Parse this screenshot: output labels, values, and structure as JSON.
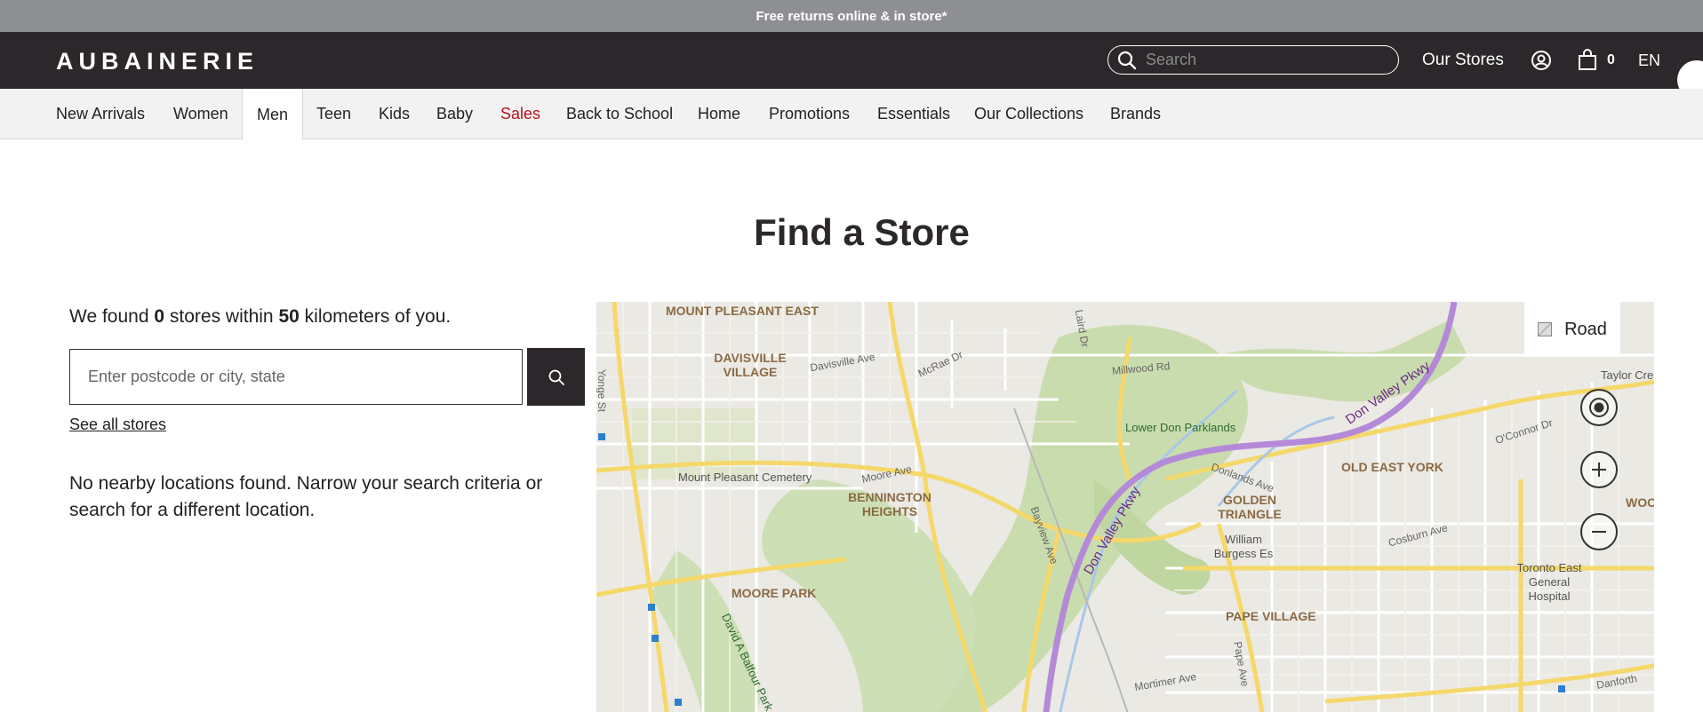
{
  "promo": {
    "text": "Free returns online & in store*"
  },
  "header": {
    "logo": "AUBAINERIE",
    "search_placeholder": "Search",
    "our_stores": "Our Stores",
    "bag_count": "0",
    "language": "EN"
  },
  "nav": {
    "items": [
      {
        "label": "New Arrivals"
      },
      {
        "label": "Women"
      },
      {
        "label": "Men"
      },
      {
        "label": "Teen"
      },
      {
        "label": "Kids"
      },
      {
        "label": "Baby"
      },
      {
        "label": "Sales"
      },
      {
        "label": "Back to School"
      },
      {
        "label": "Home"
      },
      {
        "label": "Promotions"
      },
      {
        "label": "Essentials"
      },
      {
        "label": "Our Collections"
      },
      {
        "label": "Brands"
      }
    ],
    "active": "Men",
    "highlight": "Sales"
  },
  "main": {
    "title": "Find a Store",
    "found_prefix": "We found",
    "found_count": "0",
    "found_middle": "stores within",
    "found_radius": "50",
    "found_suffix": "kilometers of you.",
    "postcode_placeholder": "Enter postcode or city, state",
    "see_all": "See all stores",
    "no_results": "No nearby locations found. Narrow your search criteria or search for a different location."
  },
  "map": {
    "road_label": "Road",
    "labels": {
      "mount_pleasant_east": "MOUNT PLEASANT EAST",
      "davisville_village": "DAVISVILLE VILLAGE",
      "davisville_ave": "Davisville Ave",
      "mcrae_dr": "McRae Dr",
      "laird_dr": "Laird Dr",
      "millwood_rd": "Millwood Rd",
      "lower_don_parklands": "Lower Don Parklands",
      "don_valley_pkwy": "Don Valley Pkwy",
      "taylor_cre": "Taylor Cre",
      "o_connor_dr": "O'Connor Dr",
      "yonge_st": "Yonge St",
      "mount_pleasant_cemetery": "Mount Pleasant Cemetery",
      "moore_ave": "Moore Ave",
      "bennington_heights": "BENNINGTON HEIGHTS",
      "bayview_ave": "Bayview Ave",
      "donlands_ave": "Donlands Ave",
      "golden_triangle": "GOLDEN TRIANGLE",
      "old_east_york": "OLD EAST YORK",
      "woo": "WOO",
      "william_burgess": "William Burgess Es",
      "cosburn_ave": "Cosburn Ave",
      "toronto_east": "Toronto East General Hospital",
      "moore_park": "MOORE PARK",
      "david_balfour": "David A Balfour Park",
      "pape_village": "PAPE VILLAGE",
      "pape_ave": "Pape Ave",
      "mortimer_ave": "Mortimer Ave",
      "danforth": "Danforth"
    }
  },
  "colors": {
    "header_bg": "#2b272b",
    "promo_bg": "#8e8f92",
    "sales_red": "#b5121b",
    "highway_purple": "#b48ad8"
  }
}
